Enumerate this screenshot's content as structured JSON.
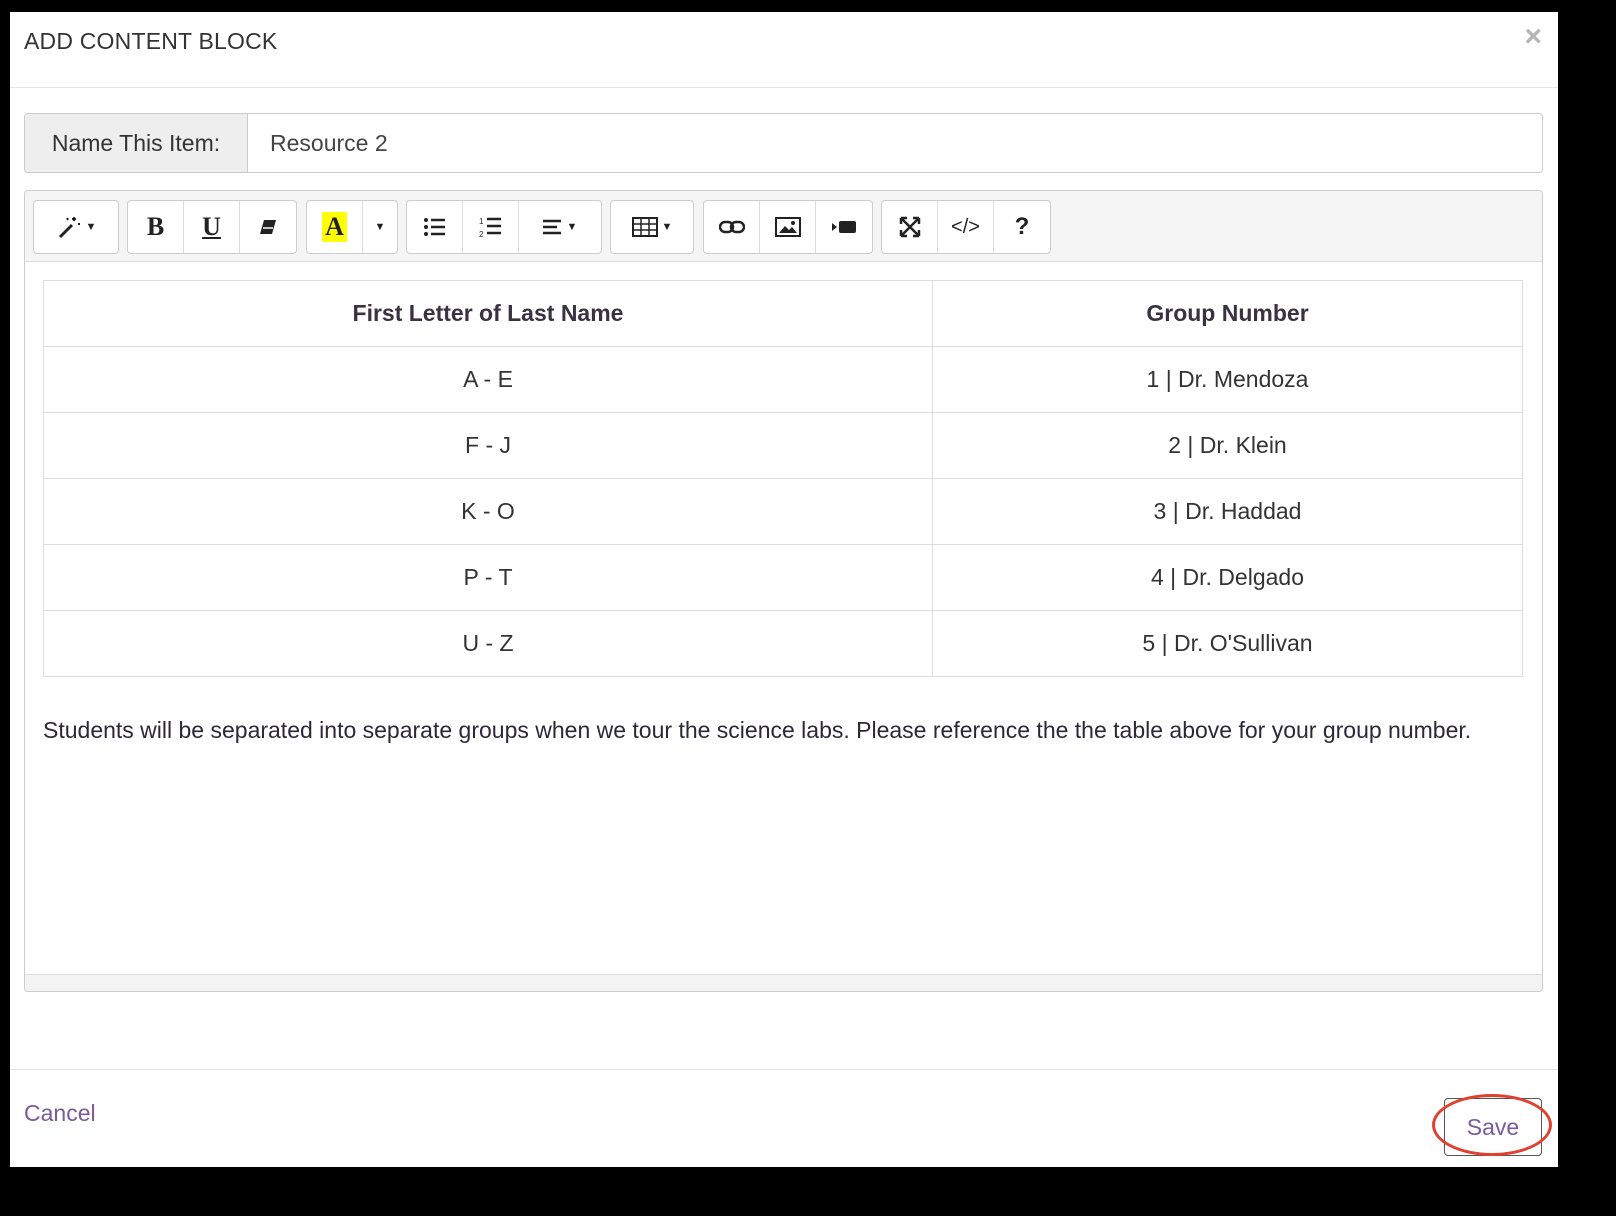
{
  "modal": {
    "title": "ADD CONTENT BLOCK",
    "close_label": "×"
  },
  "name_field": {
    "label": "Name This Item:",
    "value": "Resource 2"
  },
  "toolbar": {
    "groups": [
      [
        "magic-wand-icon"
      ],
      [
        "bold-icon",
        "underline-icon",
        "eraser-icon"
      ],
      [
        "highlight-icon",
        "caret-down-icon"
      ],
      [
        "bullet-list-icon",
        "numbered-list-icon",
        "align-icon"
      ],
      [
        "table-icon"
      ],
      [
        "link-icon",
        "image-icon",
        "video-icon"
      ],
      [
        "fullscreen-icon",
        "code-view-icon",
        "help-icon"
      ]
    ],
    "highlight_color": "#ffff00"
  },
  "table": {
    "headers": [
      "First Letter of Last Name",
      "Group Number"
    ],
    "rows": [
      [
        "A - E",
        "1 | Dr. Mendoza"
      ],
      [
        "F - J",
        "2 | Dr. Klein"
      ],
      [
        "K - O",
        "3 | Dr. Haddad"
      ],
      [
        "P - T",
        "4 | Dr. Delgado"
      ],
      [
        "U - Z",
        "5 | Dr. O'Sullivan"
      ]
    ]
  },
  "paragraph": "Students will be separated into separate groups when we tour the science labs. Please reference the the table above for your group number.",
  "footer": {
    "cancel_label": "Cancel",
    "save_label": "Save"
  },
  "colors": {
    "accent": "#7a5a9b",
    "highlight_ring": "#e0402f"
  }
}
